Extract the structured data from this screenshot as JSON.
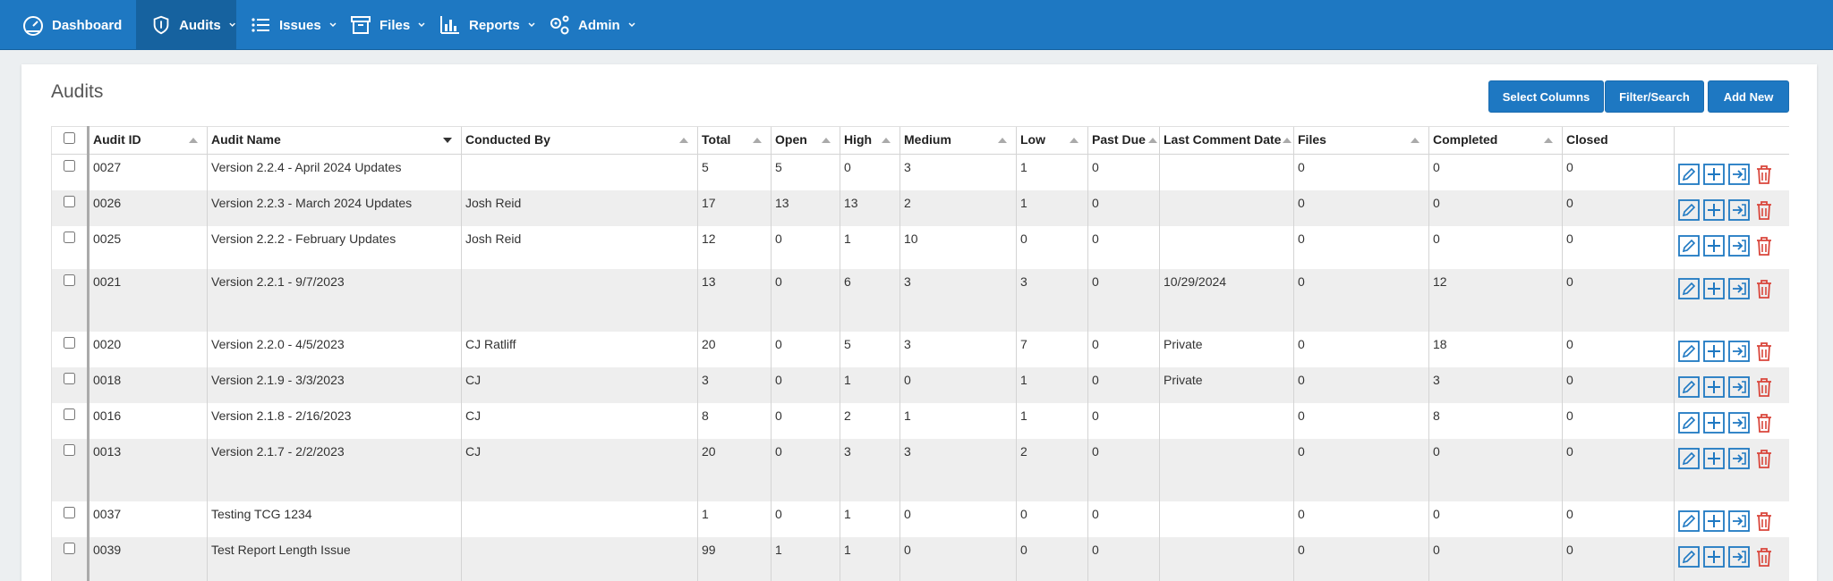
{
  "nav": {
    "items": [
      {
        "label": "Dashboard",
        "icon": "dashboard-icon"
      },
      {
        "label": "Audits",
        "icon": "shield-icon",
        "active": true
      },
      {
        "label": "Issues",
        "icon": "list-icon"
      },
      {
        "label": "Files",
        "icon": "archive-icon"
      },
      {
        "label": "Reports",
        "icon": "bar-chart-icon"
      },
      {
        "label": "Admin",
        "icon": "gears-icon"
      }
    ]
  },
  "page": {
    "title": "Audits",
    "buttons": {
      "select_columns": "Select Columns",
      "filter_search": "Filter/Search",
      "add_new": "Add New"
    }
  },
  "table": {
    "columns": [
      "Audit ID",
      "Audit Name",
      "Conducted By",
      "Total",
      "Open",
      "High",
      "Medium",
      "Low",
      "Past Due",
      "Last Comment Date",
      "Files",
      "Completed",
      "Closed"
    ],
    "rows": [
      {
        "id": "0027",
        "name": "Version 2.2.4 - April 2024 Updates",
        "by": "",
        "total": "5",
        "open": "5",
        "high": "0",
        "medium": "3",
        "low": "1",
        "past_due": "0",
        "last_comment": "",
        "files": "0",
        "completed": "0",
        "closed": "0"
      },
      {
        "id": "0026",
        "name": "Version 2.2.3 - March 2024 Updates",
        "by": "Josh Reid",
        "total": "17",
        "open": "13",
        "high": "13",
        "medium": "2",
        "low": "1",
        "past_due": "0",
        "last_comment": "",
        "files": "0",
        "completed": "0",
        "closed": "0"
      },
      {
        "id": "0025",
        "name": "Version 2.2.2 - February Updates",
        "by": "Josh Reid",
        "total": "12",
        "open": "0",
        "high": "1",
        "medium": "10",
        "low": "0",
        "past_due": "0",
        "last_comment": "",
        "files": "0",
        "completed": "0",
        "closed": "0"
      },
      {
        "id": "0021",
        "name": "Version 2.2.1 - 9/7/2023",
        "by": "",
        "total": "13",
        "open": "0",
        "high": "6",
        "medium": "3",
        "low": "3",
        "past_due": "0",
        "last_comment": "10/29/2024",
        "files": "0",
        "completed": "12",
        "closed": "0"
      },
      {
        "id": "0020",
        "name": "Version 2.2.0 - 4/5/2023",
        "by": "CJ Ratliff",
        "total": "20",
        "open": "0",
        "high": "5",
        "medium": "3",
        "low": "7",
        "past_due": "0",
        "last_comment": "Private",
        "files": "0",
        "completed": "18",
        "closed": "0"
      },
      {
        "id": "0018",
        "name": "Version 2.1.9 - 3/3/2023",
        "by": "CJ",
        "total": "3",
        "open": "0",
        "high": "1",
        "medium": "0",
        "low": "1",
        "past_due": "0",
        "last_comment": "Private",
        "files": "0",
        "completed": "3",
        "closed": "0"
      },
      {
        "id": "0016",
        "name": "Version 2.1.8 - 2/16/2023",
        "by": "CJ",
        "total": "8",
        "open": "0",
        "high": "2",
        "medium": "1",
        "low": "1",
        "past_due": "0",
        "last_comment": "",
        "files": "0",
        "completed": "8",
        "closed": "0"
      },
      {
        "id": "0013",
        "name": "Version 2.1.7 - 2/2/2023",
        "by": "CJ",
        "total": "20",
        "open": "0",
        "high": "3",
        "medium": "3",
        "low": "2",
        "past_due": "0",
        "last_comment": "",
        "files": "0",
        "completed": "0",
        "closed": "0"
      },
      {
        "id": "0037",
        "name": "Testing TCG 1234",
        "by": "",
        "total": "1",
        "open": "0",
        "high": "1",
        "medium": "0",
        "low": "0",
        "past_due": "0",
        "last_comment": "",
        "files": "0",
        "completed": "0",
        "closed": "0"
      },
      {
        "id": "0039",
        "name": "Test Report Length Issue",
        "by": "",
        "total": "99",
        "open": "1",
        "high": "1",
        "medium": "0",
        "low": "0",
        "past_due": "0",
        "last_comment": "",
        "files": "0",
        "completed": "0",
        "closed": "0"
      }
    ],
    "row_actions": [
      "edit-icon",
      "add-icon",
      "export-icon",
      "delete-icon"
    ]
  },
  "colors": {
    "nav_bg": "#1e78c2",
    "nav_active": "#16629f",
    "action_blue": "#1e78c2",
    "delete_red": "#d9463b",
    "row_alt": "#eeeeee"
  }
}
